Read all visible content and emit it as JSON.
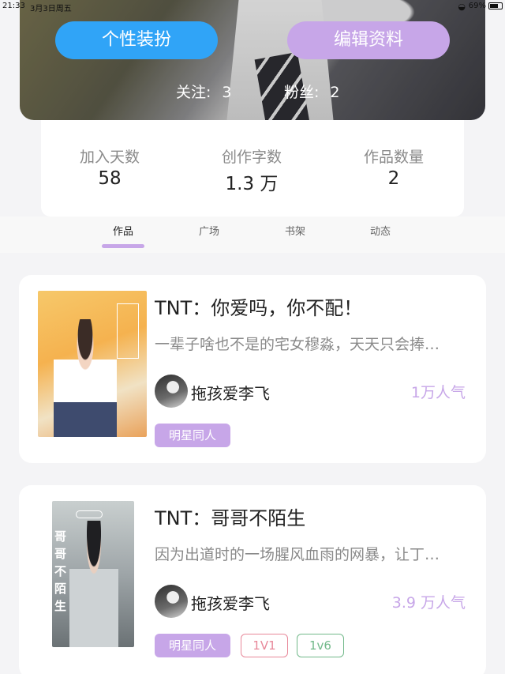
{
  "status_bar": {
    "time": "21:33",
    "date": "3月3日周五",
    "battery": "69%",
    "battery_level": 0.69
  },
  "profile": {
    "dress_button": "个性装扮",
    "edit_button": "编辑资料",
    "following_label": "关注:",
    "following_count": "3",
    "fans_label": "粉丝:",
    "fans_count": "2"
  },
  "stats": [
    {
      "label": "加入天数",
      "value": "58"
    },
    {
      "label": "创作字数",
      "value": "1.3 万"
    },
    {
      "label": "作品数量",
      "value": "2"
    }
  ],
  "tabs": [
    {
      "label": "作品",
      "active": true
    },
    {
      "label": "广场",
      "active": false
    },
    {
      "label": "书架",
      "active": false
    },
    {
      "label": "动态",
      "active": false
    }
  ],
  "works": [
    {
      "title": "TNT：你爱吗，你不配！",
      "description": "一辈子啥也不是的宅女穆淼，天天只会捧…",
      "author": "拖孩爱李飞",
      "popularity": "1万人气",
      "tags": [
        "明星同人"
      ]
    },
    {
      "title": "TNT：哥哥不陌生",
      "description": "因为出道时的一场腥风血雨的网暴，让丁…",
      "author": "拖孩爱李飞",
      "popularity": "3.9 万人气",
      "tags": [
        "明星同人",
        "1V1",
        "1v6"
      ],
      "cover_text": "哥 哥 不 陌 生"
    }
  ],
  "colors": {
    "accent_blue": "#30a4f7",
    "accent_purple": "#c7a6e8",
    "tag_pink": "#e8889a",
    "tag_green": "#72b98a"
  }
}
